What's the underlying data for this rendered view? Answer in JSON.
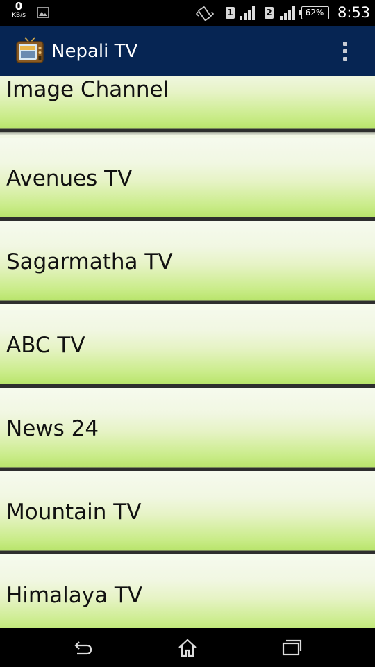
{
  "status_bar": {
    "speed_value": "0",
    "speed_unit": "KB/s",
    "sim1_label": "1",
    "sim2_label": "2",
    "battery_level": "62%",
    "time": "8:53",
    "icons": [
      "gallery-icon",
      "vibrate-icon",
      "signal-icon",
      "battery-icon"
    ]
  },
  "action_bar": {
    "title": "Nepali TV",
    "app_icon": "tv-icon",
    "menu_icon": "overflow-menu-icon",
    "background_color": "#062553"
  },
  "channels": [
    {
      "label": "Image Channel"
    },
    {
      "label": "Avenues TV"
    },
    {
      "label": "Sagarmatha TV"
    },
    {
      "label": "ABC TV"
    },
    {
      "label": "News 24"
    },
    {
      "label": "Mountain TV"
    },
    {
      "label": "Himalaya TV"
    }
  ],
  "nav_bar": {
    "icons": [
      "back-icon",
      "home-icon",
      "recent-apps-icon"
    ]
  },
  "colors": {
    "list_gradient_top": "#f6faee",
    "list_gradient_bottom": "#b8e46b",
    "divider": "#2e2e2e"
  }
}
